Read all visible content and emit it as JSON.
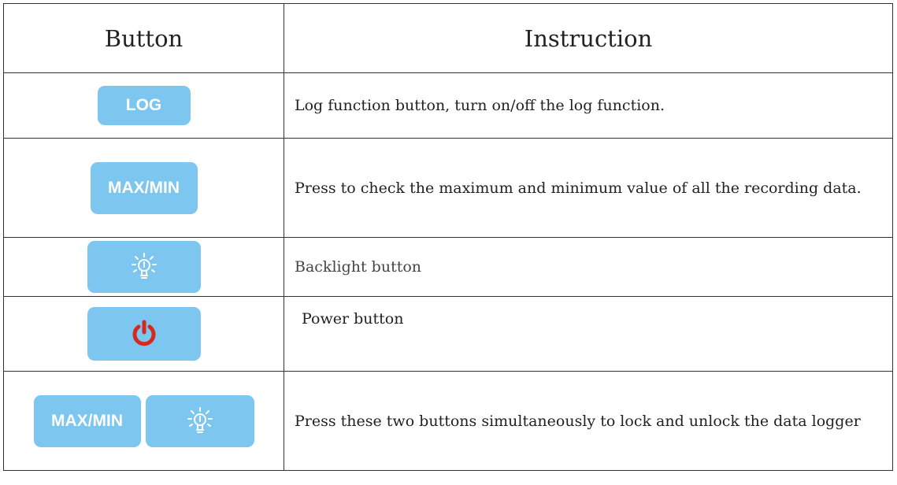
{
  "headers": {
    "button": "Button",
    "instruction": "Instruction"
  },
  "rows": [
    {
      "button_label": "LOG",
      "description": "Log function button, turn on/off the log function."
    },
    {
      "button_label": "MAX/MIN",
      "description": "Press to check the maximum and minimum value of all the recording data."
    },
    {
      "button_icon": "lightbulb-icon",
      "description": "Backlight button"
    },
    {
      "button_icon": "power-icon",
      "description": "Power button"
    },
    {
      "button_label": "MAX/MIN",
      "button_icon": "lightbulb-icon",
      "description": "Press these two buttons simultaneously to lock and unlock the data logger"
    }
  ],
  "colors": {
    "button_fill": "#7cc6ef",
    "button_text": "#ffffff",
    "power_symbol": "#d42a1e"
  }
}
